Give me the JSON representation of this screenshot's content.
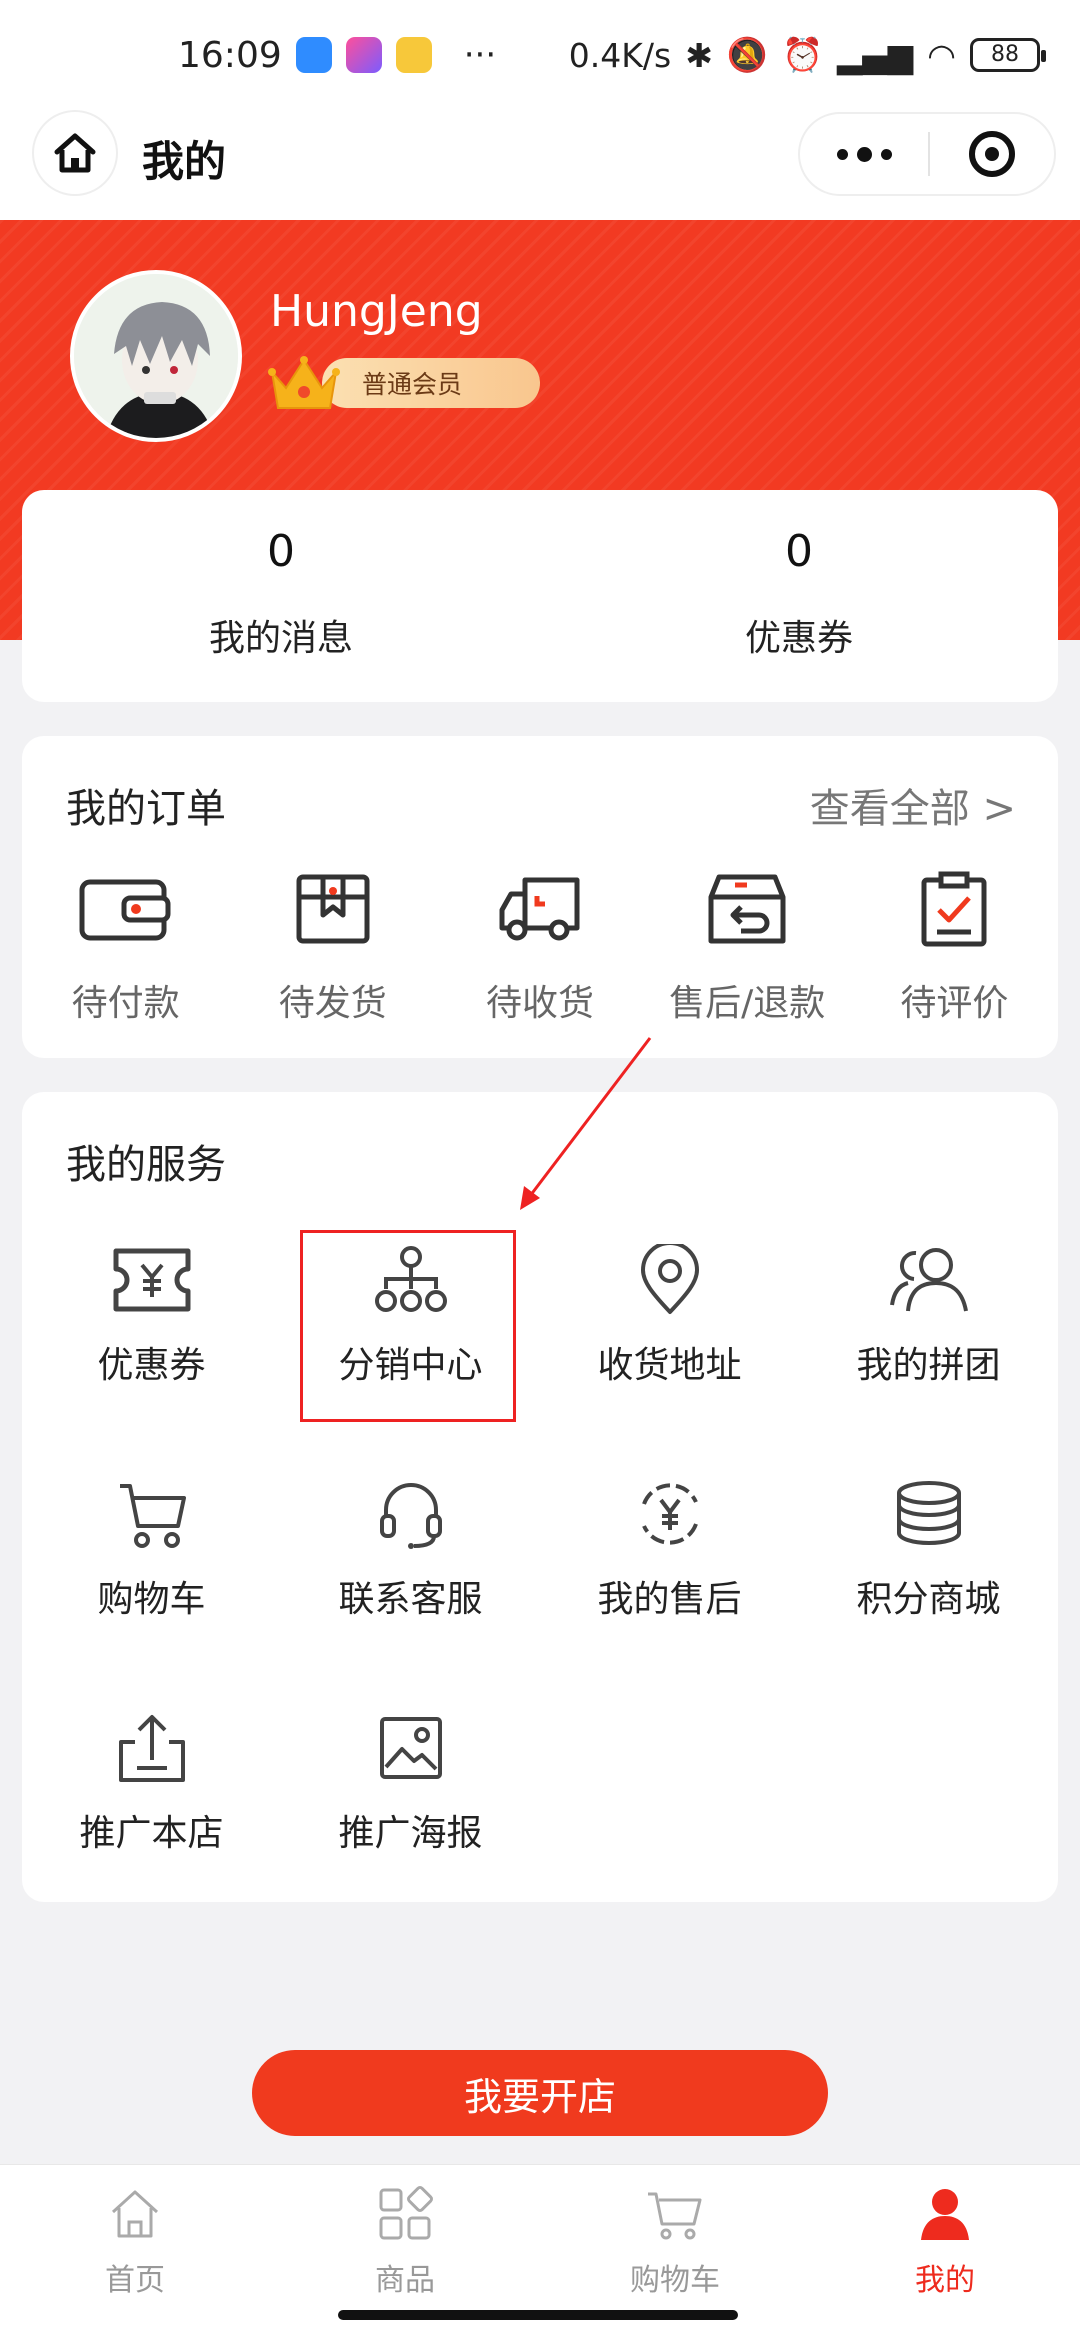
{
  "status_bar": {
    "time": "16:09",
    "dots": "···",
    "net_speed": "0.4K/s",
    "battery": "88"
  },
  "header": {
    "title": "我的"
  },
  "profile": {
    "username": "HungJeng",
    "member_level": "普通会员"
  },
  "stats": [
    {
      "value": "0",
      "label": "我的消息"
    },
    {
      "value": "0",
      "label": "优惠券"
    }
  ],
  "orders": {
    "title": "我的订单",
    "view_all": "查看全部 >",
    "items": [
      {
        "label": "待付款",
        "icon": "wallet-icon"
      },
      {
        "label": "待发货",
        "icon": "package-icon"
      },
      {
        "label": "待收货",
        "icon": "truck-icon"
      },
      {
        "label": "售后/退款",
        "icon": "return-box-icon"
      },
      {
        "label": "待评价",
        "icon": "clipboard-check-icon"
      }
    ]
  },
  "services": {
    "title": "我的服务",
    "items": [
      {
        "label": "优惠券",
        "icon": "coupon-icon"
      },
      {
        "label": "分销中心",
        "icon": "org-chart-icon"
      },
      {
        "label": "收货地址",
        "icon": "location-pin-icon"
      },
      {
        "label": "我的拼团",
        "icon": "group-users-icon"
      },
      {
        "label": "购物车",
        "icon": "cart-icon"
      },
      {
        "label": "联系客服",
        "icon": "headset-icon"
      },
      {
        "label": "我的售后",
        "icon": "yen-refresh-icon"
      },
      {
        "label": "积分商城",
        "icon": "coin-stack-icon"
      },
      {
        "label": "推广本店",
        "icon": "upload-share-icon"
      },
      {
        "label": "推广海报",
        "icon": "poster-image-icon"
      }
    ]
  },
  "open_store_button": "我要开店",
  "tabs": [
    {
      "label": "首页",
      "icon": "home-icon",
      "active": false
    },
    {
      "label": "商品",
      "icon": "grid-icon",
      "active": false
    },
    {
      "label": "购物车",
      "icon": "cart-icon",
      "active": false
    },
    {
      "label": "我的",
      "icon": "user-icon",
      "active": true
    }
  ],
  "colors": {
    "brand_red": "#f23a22",
    "highlight_red": "#ee2222",
    "text_gray": "#666666"
  }
}
